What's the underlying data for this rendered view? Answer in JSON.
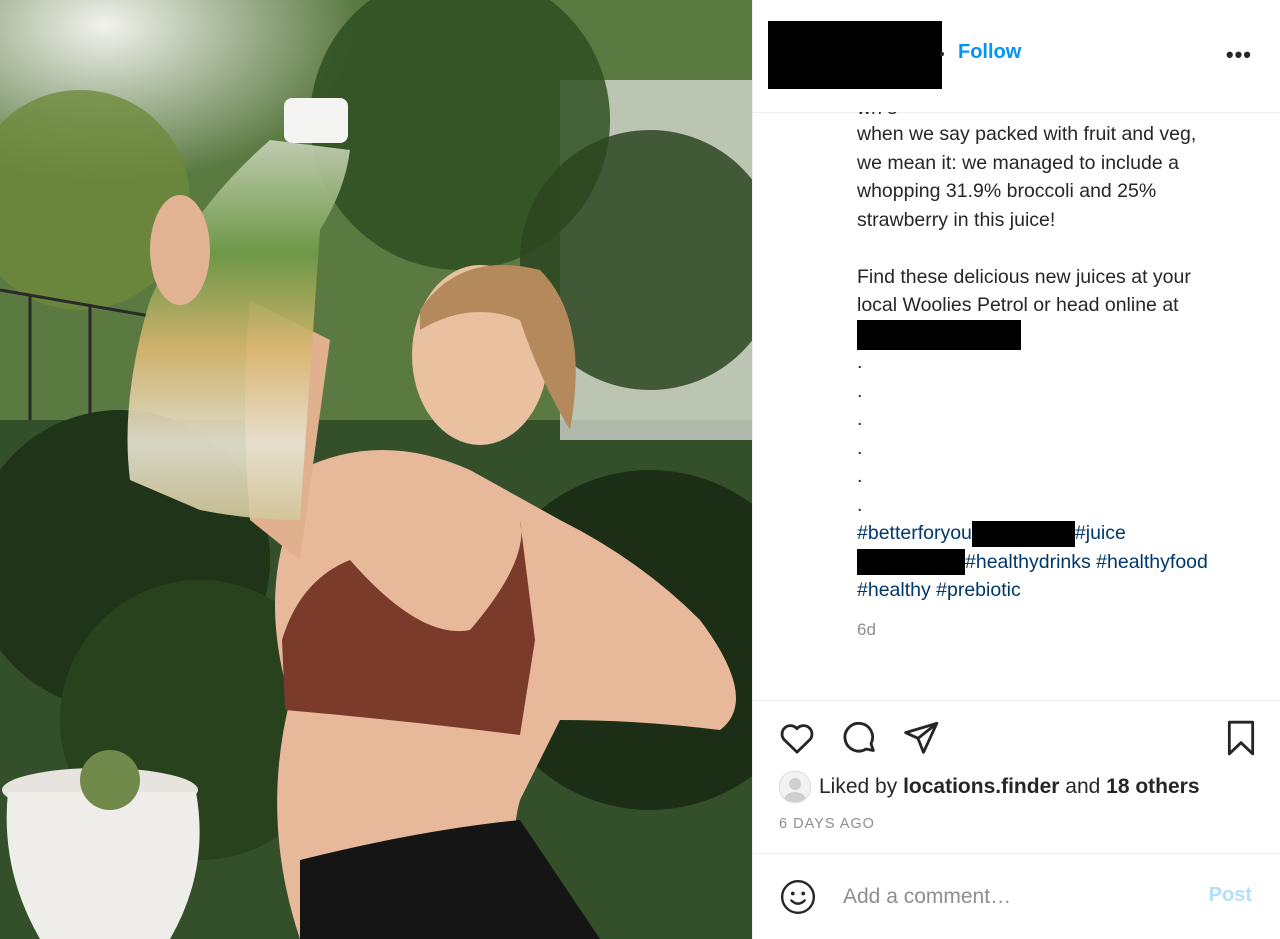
{
  "post": {
    "header": {
      "follow_label": "Follow",
      "more_label": "•••"
    },
    "caption": {
      "cut_line": "wh               s",
      "lines": [
        "when we say packed with fruit and veg,",
        "we mean it: we managed to include a",
        "whopping 31.9% broccoli and 25%",
        "strawberry in this juice!",
        "",
        "Find these delicious new juices at your",
        "local Woolies Petrol or head online at"
      ],
      "dots": [
        ".",
        ".",
        ".",
        ".",
        ".",
        "."
      ],
      "hashtags": {
        "tag1": "#betterforyou",
        "tag2": "#juice",
        "tag3": "#healthydrinks",
        "tag4": "#healthyfood",
        "tag5": "#healthy",
        "tag6": "#prebiotic"
      }
    },
    "time_short": "6d",
    "actions": {
      "like_icon": "heart-icon",
      "comment_icon": "comment-icon",
      "share_icon": "share-icon",
      "save_icon": "bookmark-icon"
    },
    "likes": {
      "prefix": "Liked by",
      "user": "locations.finder",
      "middle": "and",
      "others": "18 others"
    },
    "time_long": "6 DAYS AGO",
    "comment_box": {
      "placeholder": "Add a comment…",
      "post_label": "Post"
    },
    "colors": {
      "link": "#00376b",
      "follow": "#0095f6",
      "post_disabled": "#b2dffc",
      "muted": "#8e8e8e"
    }
  }
}
